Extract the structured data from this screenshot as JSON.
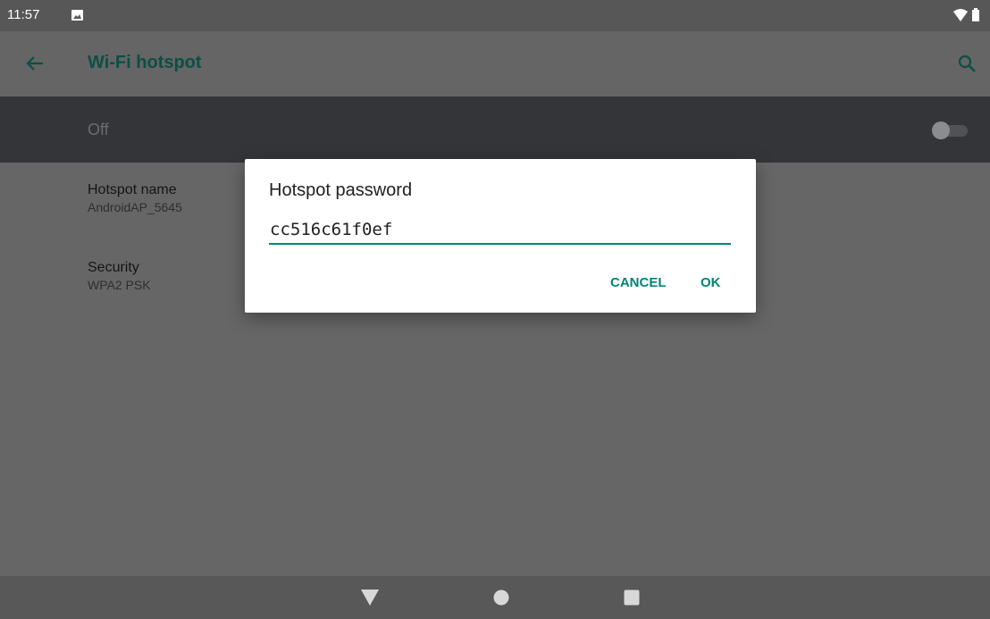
{
  "status_bar": {
    "time": "11:57",
    "icons": [
      "image-notification-icon",
      "wifi-icon",
      "battery-icon"
    ]
  },
  "app_bar": {
    "title": "Wi-Fi hotspot",
    "icons": [
      "back-arrow-icon",
      "search-icon"
    ]
  },
  "master_switch": {
    "label": "Off",
    "checked": false
  },
  "preferences": [
    {
      "title": "Hotspot name",
      "summary": "AndroidAP_5645"
    },
    {
      "title": "Security",
      "summary": "WPA2 PSK"
    }
  ],
  "dialog": {
    "title": "Hotspot password",
    "password_value": "cc516c61f0ef",
    "cancel_label": "CANCEL",
    "ok_label": "OK"
  },
  "nav_bar": {
    "icons": [
      "nav-back-icon",
      "nav-home-icon",
      "nav-recents-icon"
    ]
  },
  "colors": {
    "accent": "#008577",
    "scrim": "#666666",
    "switch_bar": "#333538",
    "title_dimmed": "#0b4f45"
  }
}
